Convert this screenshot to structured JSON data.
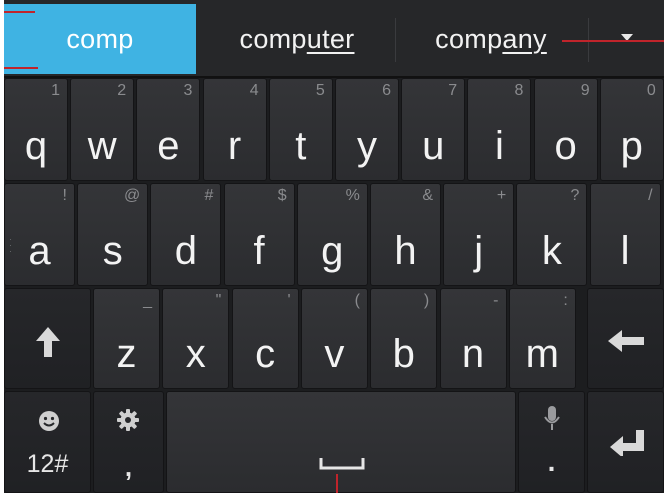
{
  "suggestions": [
    {
      "label": "comp",
      "selected": true
    },
    {
      "prefix": "comp",
      "underlined": "uter"
    },
    {
      "prefix": "comp",
      "underlined": "any"
    }
  ],
  "rows": [
    [
      {
        "label": "q",
        "hint": "1"
      },
      {
        "label": "w",
        "hint": "2"
      },
      {
        "label": "e",
        "hint": "3"
      },
      {
        "label": "r",
        "hint": "4"
      },
      {
        "label": "t",
        "hint": "5"
      },
      {
        "label": "y",
        "hint": "6"
      },
      {
        "label": "u",
        "hint": "7"
      },
      {
        "label": "i",
        "hint": "8"
      },
      {
        "label": "o",
        "hint": "9"
      },
      {
        "label": "p",
        "hint": "0"
      }
    ],
    [
      {
        "label": "a",
        "hint": "!"
      },
      {
        "label": "s",
        "hint": "@"
      },
      {
        "label": "d",
        "hint": "#"
      },
      {
        "label": "f",
        "hint": "$"
      },
      {
        "label": "g",
        "hint": "%"
      },
      {
        "label": "h",
        "hint": "&"
      },
      {
        "label": "j",
        "hint": "+"
      },
      {
        "label": "k",
        "hint": "?"
      },
      {
        "label": "l",
        "hint": "/"
      }
    ],
    [
      {
        "label": "z",
        "hint": "_"
      },
      {
        "label": "x",
        "hint": "\""
      },
      {
        "label": "c",
        "hint": "'"
      },
      {
        "label": "v",
        "hint": "("
      },
      {
        "label": "b",
        "hint": ")"
      },
      {
        "label": "n",
        "hint": "-"
      },
      {
        "label": "m",
        "hint": ":"
      }
    ]
  ],
  "bottom": {
    "symbols_label": "12#",
    "comma_label": ",",
    "period_label": "."
  },
  "icons": {
    "shift": "up-arrow",
    "backspace": "left-arrow",
    "emoji": "smiley",
    "settings": "gear",
    "voice": "microphone",
    "enter": "return-arrow",
    "space": "space-bar",
    "more": "chevron-down"
  },
  "colors": {
    "highlight": "#3fb3e3",
    "annotation": "#c0242b",
    "keyboard_bg": "#1c1d1f"
  }
}
